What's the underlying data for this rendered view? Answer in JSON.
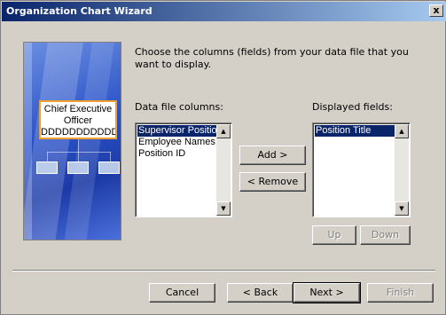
{
  "window": {
    "title": "Organization Chart Wizard"
  },
  "graphic": {
    "ceo_line1": "Chief Executive",
    "ceo_line2": "Officer",
    "ceo_line3": "DDDDDDDDDDDDD"
  },
  "instructions": "Choose the columns (fields) from your data file that you",
  "instructions2": "want to display.",
  "data_columns": {
    "label": "Data file columns:",
    "items": [
      "Supervisor Position",
      "Employee Names",
      "Position ID"
    ],
    "selected": "Supervisor Position"
  },
  "displayed_fields": {
    "label": "Displayed fields:",
    "items": [
      "Position Title"
    ],
    "selected": "Position Title"
  },
  "buttons": {
    "add": "Add >",
    "remove": "< Remove",
    "up": "Up",
    "down": "Down",
    "cancel": "Cancel",
    "back": "< Back",
    "next": "Next >",
    "finish": "Finish",
    "close": "x"
  },
  "colors": {
    "title_bar": "#0a246a",
    "selection": "#0a246a",
    "face": "#d4d0c8"
  }
}
